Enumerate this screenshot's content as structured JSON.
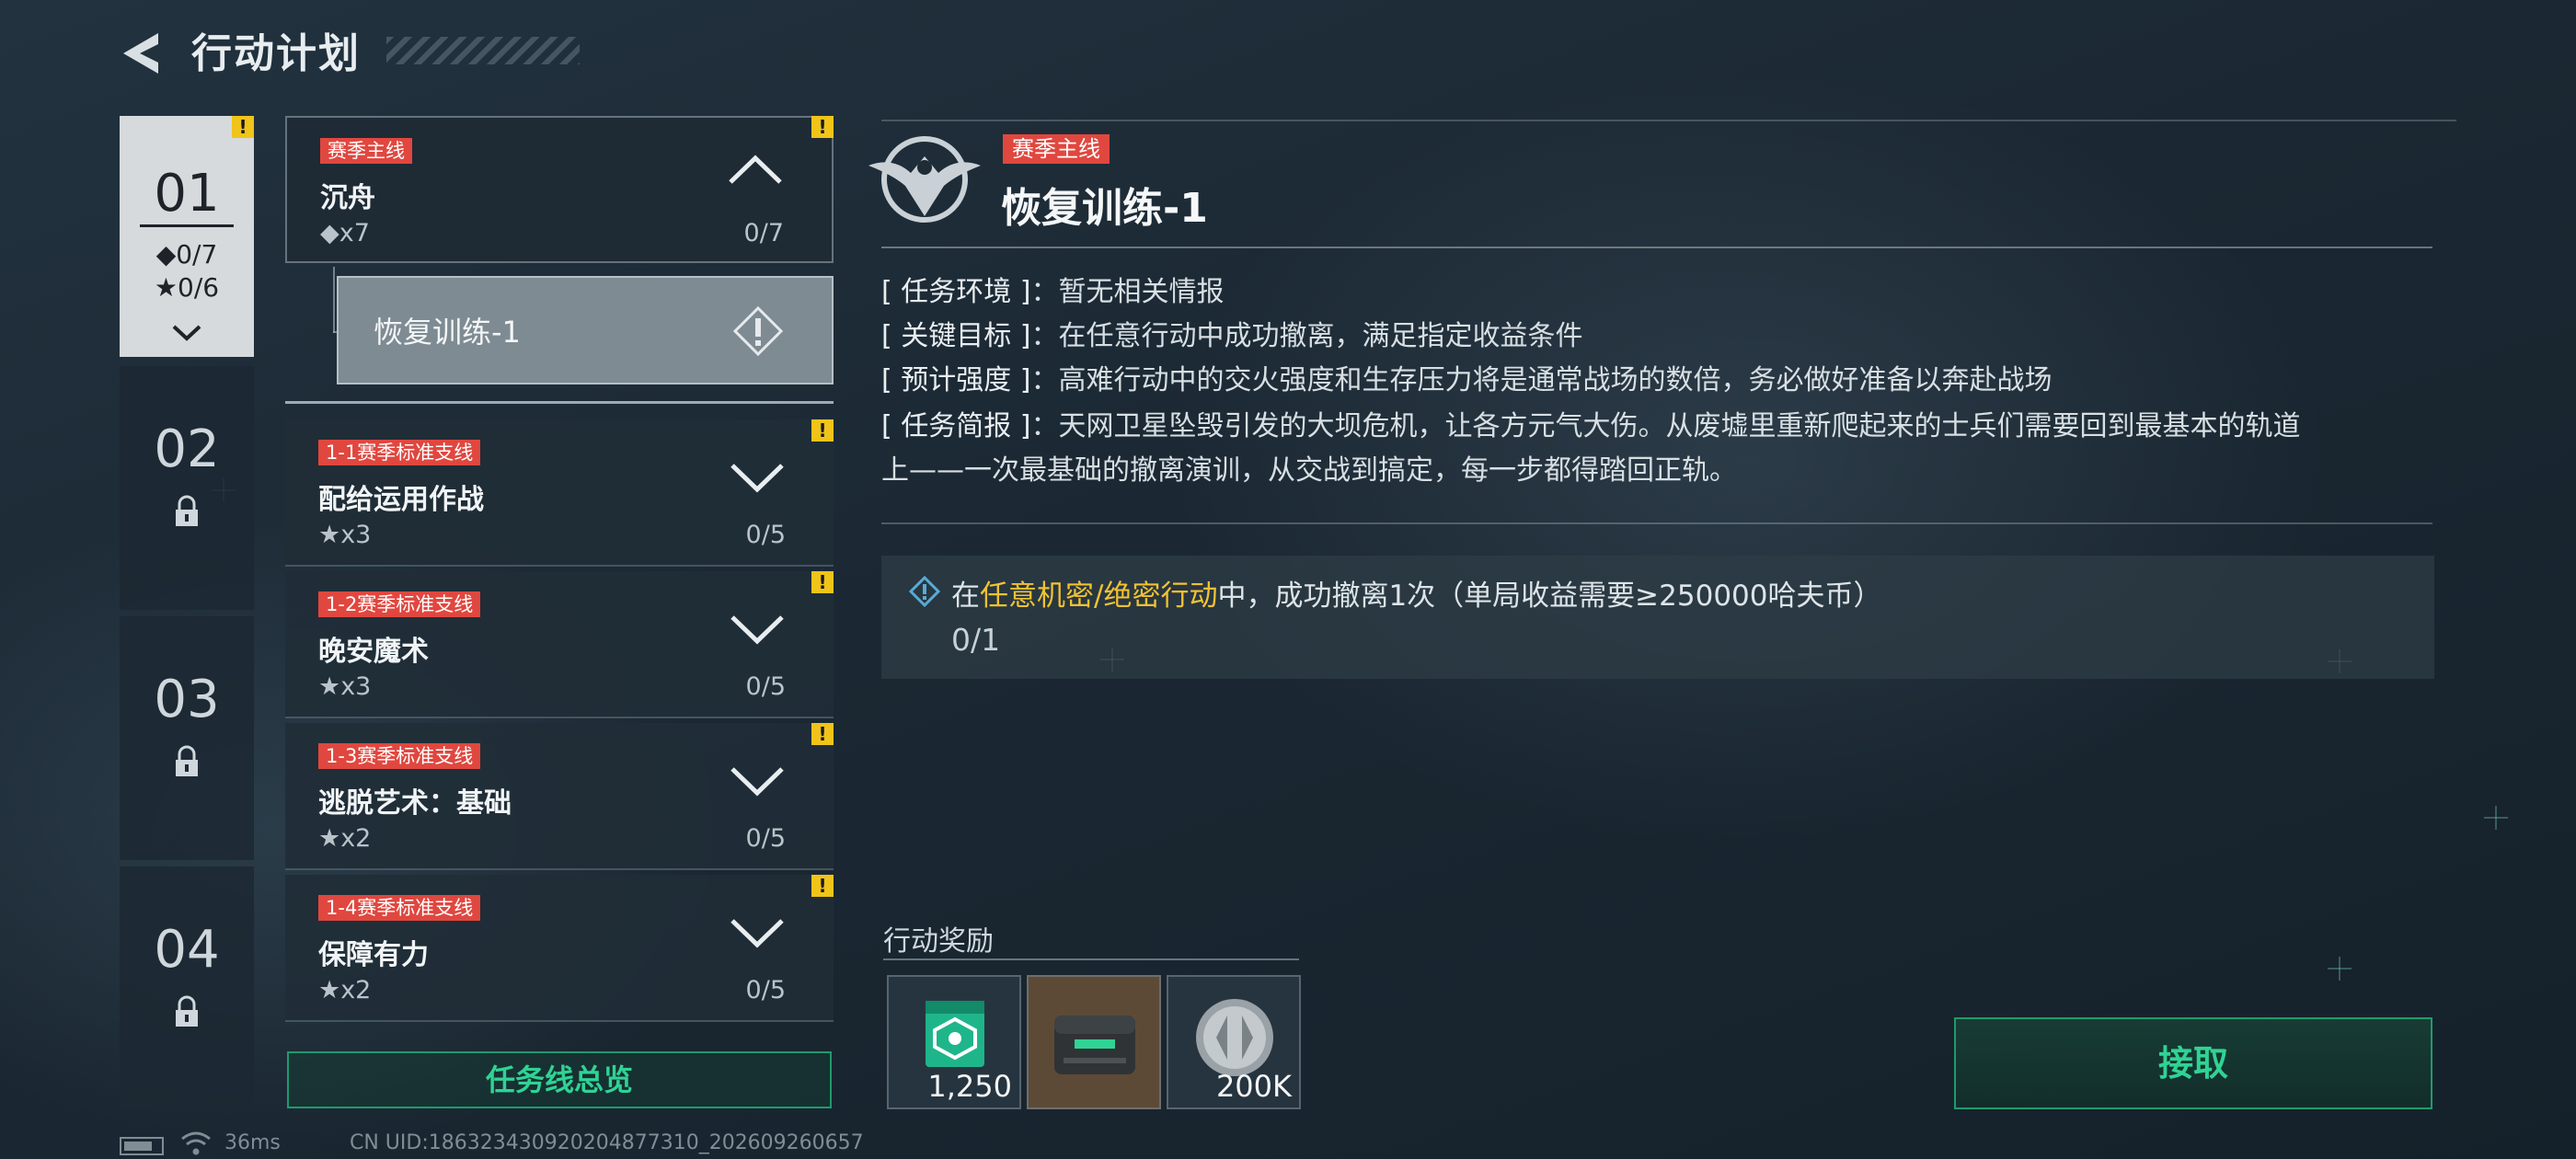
{
  "header": {
    "title": "行动计划"
  },
  "chapters": [
    {
      "num": "01",
      "diamond_stat": "◆0/7",
      "star_stat": "★0/6"
    },
    {
      "num": "02"
    },
    {
      "num": "03"
    },
    {
      "num": "04"
    }
  ],
  "missions": [
    {
      "tag": "赛季主线",
      "name": "沉舟",
      "reward": "◆x7",
      "progress": "0/7"
    },
    {
      "tag": "1-1赛季标准支线",
      "name": "配给运用作战",
      "reward": "★x3",
      "progress": "0/5"
    },
    {
      "tag": "1-2赛季标准支线",
      "name": "晚安魔术",
      "reward": "★x3",
      "progress": "0/5"
    },
    {
      "tag": "1-3赛季标准支线",
      "name": "逃脱艺术：基础",
      "reward": "★x2",
      "progress": "0/5"
    },
    {
      "tag": "1-4赛季标准支线",
      "name": "保障有力",
      "reward": "★x2",
      "progress": "0/5"
    }
  ],
  "sub_mission": {
    "label": "恢复训练-1"
  },
  "overview_button": "任务线总览",
  "detail": {
    "tag": "赛季主线",
    "title": "恢复训练-1",
    "rows": [
      {
        "label": "[ 任务环境 ]",
        "value": "：暂无相关情报"
      },
      {
        "label": "[ 关键目标 ]",
        "value": "：在任意行动中成功撤离，满足指定收益条件"
      },
      {
        "label": "[ 预计强度 ]",
        "value": "：高难行动中的交火强度和生存压力将是通常战场的数倍，务必做好准备以奔赴战场"
      },
      {
        "label": "[ 任务简报 ]",
        "value": "：天网卫星坠毁引发的大坝危机，让各方元气大伤。从废墟里重新爬起来的士兵们需要回到最基本的轨道"
      }
    ],
    "brief_cont": "上——一次最基础的撤离演训，从交战到搞定，每一步都得踏回正轨。",
    "objective": {
      "prefix": "在",
      "highlight": "任意机密/绝密行动",
      "suffix": "中，成功撤离1次（单局收益需要≥250000哈夫币）",
      "progress": "0/1"
    }
  },
  "rewards": {
    "title": "行动奖励",
    "items": [
      {
        "icon": "green-voucher-icon",
        "qty": "1,250"
      },
      {
        "icon": "equipment-case-icon",
        "qty": ""
      },
      {
        "icon": "silver-coin-icon",
        "qty": "200K"
      }
    ]
  },
  "accept_button": "接取",
  "status": {
    "ping": "36ms",
    "uid": "CN UID:18632343092020487731​0_202609260657"
  },
  "colors": {
    "accent_green": "#2fd394",
    "tag_red": "#e0473f",
    "highlight_yellow": "#f1c232",
    "warn_yellow": "#f0c419"
  }
}
